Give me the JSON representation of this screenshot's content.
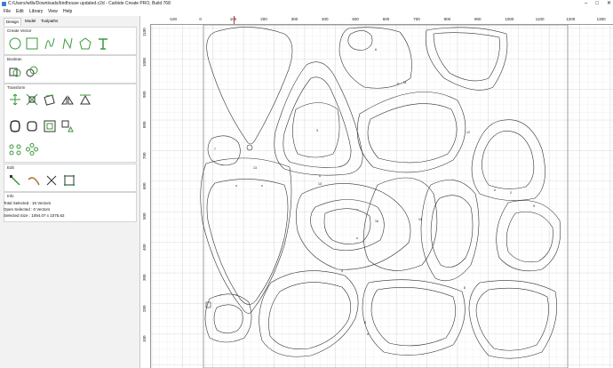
{
  "window": {
    "title": "C:/Users/wills/Downloads/birdhouse updated.c2d - Carbide Create PRO, Build 768",
    "minimize": "–",
    "maximize": "□",
    "close": "✕"
  },
  "menu": {
    "file": "File",
    "edit": "Edit",
    "library": "Library",
    "view": "View",
    "help": "Help"
  },
  "tabs": {
    "design": "Design",
    "model": "Model",
    "toolpaths": "Toolpaths"
  },
  "sections": {
    "create_vector": "Create Vector",
    "boolean": "Boolean",
    "transform": "Transform",
    "edit": "Edit",
    "info": "Info"
  },
  "tools": {
    "create_vector": [
      "circle-icon",
      "rectangle-icon",
      "curve-icon",
      "polyline-icon",
      "polygon-icon",
      "text-icon"
    ],
    "boolean": [
      "join-icon",
      "weld-icon"
    ],
    "transform": [
      "align-icon",
      "scale-icon",
      "rotate-icon",
      "mirror-icon",
      "array-icon",
      "offset-icon",
      "fillet-icon",
      "inset-icon",
      "group-icon",
      "ungroup-icon",
      "circular-array-icon",
      "pattern-icon"
    ],
    "edit": [
      "node-edit-icon",
      "trim-icon",
      "cut-icon",
      "bounds-icon"
    ]
  },
  "info": {
    "total_selected": "Total Selected : 15 Vectors",
    "open_selected": "Open Selected : 0 Vectors",
    "selected_size": "Selected Size : 1094.07 x 1075.62"
  },
  "ruler": {
    "x_labels": [
      "-100",
      "0",
      "100",
      "200",
      "300",
      "400",
      "500",
      "600",
      "700",
      "800",
      "900",
      "1000",
      "1100",
      "1200",
      "1300"
    ],
    "y_labels": [
      "1100",
      "1000",
      "900",
      "800",
      "700",
      "600",
      "500",
      "400",
      "300",
      "200",
      "100"
    ]
  },
  "shape_labels": [
    "7",
    "13",
    "13",
    "12",
    "6",
    "11",
    "16",
    "14",
    "9",
    "4",
    "5",
    "8",
    "2",
    "3"
  ],
  "colors": {
    "accent_green": "#3a9a3a",
    "grid": "#dcdcdc",
    "ruler_marker": "#d03030"
  }
}
